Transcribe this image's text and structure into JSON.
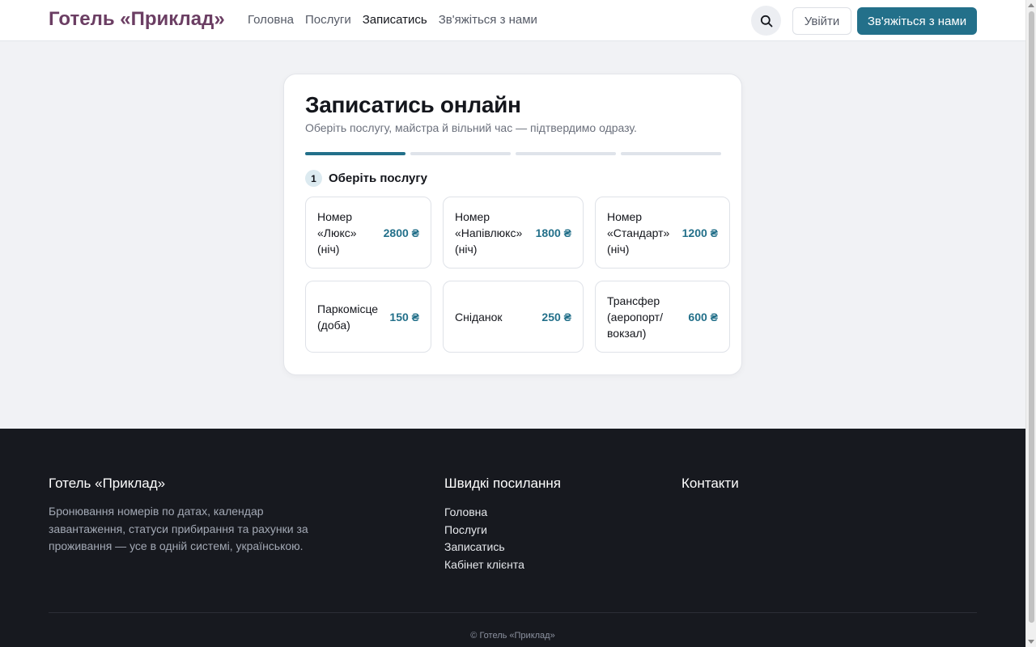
{
  "header": {
    "brand": "Готель «Приклад»",
    "nav": [
      {
        "label": "Головна",
        "active": false
      },
      {
        "label": "Послуги",
        "active": false
      },
      {
        "label": "Записатись",
        "active": true
      },
      {
        "label": "Зв'яжіться з нами",
        "active": false
      }
    ],
    "search_icon": "search-icon",
    "login_label": "Увійти",
    "contact_label": "Зв'яжіться з нами"
  },
  "booking": {
    "title": "Записатись онлайн",
    "subtitle": "Оберіть послугу, майстра й вільний час — підтвердимо одразу.",
    "progress": {
      "current_step": 1,
      "total_steps": 4
    },
    "step_number": "1",
    "step_label": "Оберіть послугу",
    "services": [
      {
        "name": "Номер «Люкс» (ніч)",
        "price": "2800 ₴"
      },
      {
        "name": "Номер «Напівлюкс» (ніч)",
        "price": "1800 ₴"
      },
      {
        "name": "Номер «Стандарт» (ніч)",
        "price": "1200 ₴"
      },
      {
        "name": "Паркомісце (доба)",
        "price": "150 ₴"
      },
      {
        "name": "Сніданок",
        "price": "250 ₴"
      },
      {
        "name": "Трансфер (аеропорт/вокзал)",
        "price": "600 ₴"
      }
    ]
  },
  "footer": {
    "about_title": "Готель «Приклад»",
    "about_text": "Бронювання номерів по датах, календар завантаження, статуси прибирання та рахунки за проживання — усе в одній системі, українською.",
    "links_title": "Швидкі посилання",
    "links": [
      "Головна",
      "Послуги",
      "Записатись",
      "Кабінет клієнта"
    ],
    "contacts_title": "Контакти",
    "copyright": "© Готель «Приклад»"
  },
  "colors": {
    "brand": "#6b3e63",
    "accent": "#23708a",
    "footer_bg": "#17191f"
  }
}
